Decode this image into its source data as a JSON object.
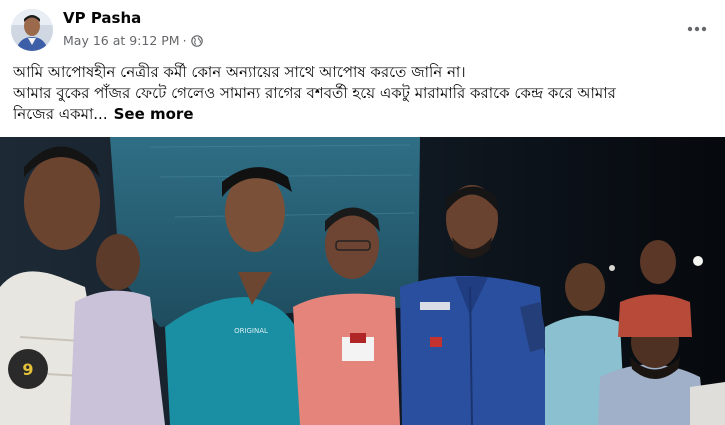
{
  "post": {
    "author_name": "VP Pasha",
    "timestamp": "May 16 at 9:12 PM",
    "separator": "·",
    "audience_icon": "globe-icon",
    "more_icon": "more-horizontal-icon",
    "text_lines": [
      "আমি আপোষহীন  নেত্রীর কর্মী কোন অন্যায়ের সাথে আপোষ করতে জানি না।",
      "আমার বুকের পাঁজর ফেটে গেলেও সামান্য রাগের বশবর্তী হয়ে একটু মারামারি   করাকে কেন্দ্র করে আমার",
      "নিজের একমা..."
    ],
    "see_more_label": "See more"
  },
  "photo": {
    "shirt_texts": [
      "ORIGINAL",
      "9"
    ]
  },
  "colors": {
    "text_primary": "#050505",
    "text_secondary": "#65676b",
    "police_uniform": "#2a4f9e",
    "teal_shirt": "#1a8fa3",
    "pink_shirt": "#e4847a"
  }
}
